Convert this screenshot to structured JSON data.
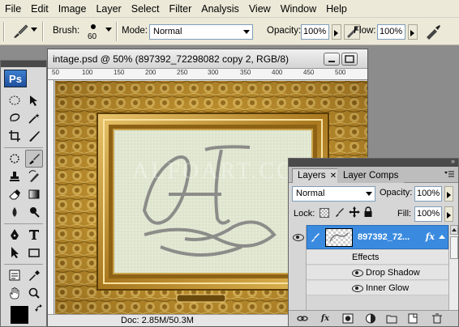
{
  "menu": [
    "File",
    "Edit",
    "Image",
    "Layer",
    "Select",
    "Filter",
    "Analysis",
    "View",
    "Window",
    "Help"
  ],
  "options": {
    "brush_label": "Brush:",
    "brush_size": "60",
    "mode_label": "Mode:",
    "mode_value": "Normal",
    "opacity_label": "Opacity:",
    "opacity_value": "100%",
    "flow_label": "Flow:",
    "flow_value": "100%"
  },
  "toolbox": {
    "logo": "Ps"
  },
  "document": {
    "title": "intage.psd @ 50% (897392_72298082 copy 2, RGB/8)",
    "status": "Doc: 2.85M/50.3M",
    "ruler_numbers": [
      "50",
      "100",
      "150",
      "200",
      "250",
      "300",
      "350",
      "400",
      "450",
      "500"
    ],
    "watermark": "ALFOART.COM",
    "monogram": "ΑΓ"
  },
  "layers_panel": {
    "tab_layers": "Layers",
    "tab_comps": "Layer Comps",
    "blend_mode": "Normal",
    "opacity_label": "Opacity:",
    "opacity_value": "100%",
    "lock_label": "Lock:",
    "fill_label": "Fill:",
    "fill_value": "100%",
    "layer_name": "897392_72...",
    "fx_label": "fx",
    "effects_label": "Effects",
    "effects": [
      "Drop Shadow",
      "Inner Glow"
    ]
  }
}
